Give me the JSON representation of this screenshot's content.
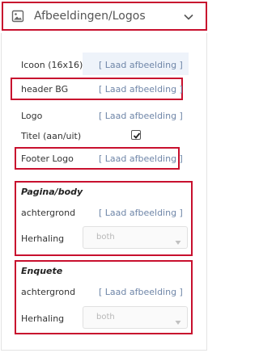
{
  "header": {
    "title": "Afbeeldingen/Logos"
  },
  "rows": {
    "icon": {
      "label": "Icoon (16x16)",
      "action": "[ Laad afbeelding ]"
    },
    "header_bg": {
      "label": "header BG",
      "action": "[ Laad afbeelding ]"
    },
    "logo": {
      "label": "Logo",
      "action": "[ Laad afbeelding ]"
    },
    "title_toggle": {
      "label": "Titel (aan/uit)",
      "checked": true
    },
    "footer_logo": {
      "label": "Footer Logo",
      "action": "[ Laad afbeelding ]"
    }
  },
  "sections": {
    "pagina_body": {
      "title": "Pagina/body",
      "background_label": "achtergrond",
      "background_action": "[ Laad afbeelding ]",
      "repeat_label": "Herhaling",
      "repeat_value": "both"
    },
    "enquete": {
      "title": "Enquete",
      "background_label": "achtergrond",
      "background_action": "[ Laad afbeelding ]",
      "repeat_label": "Herhaling",
      "repeat_value": "both"
    }
  },
  "colors": {
    "highlight": "#c8102e",
    "link": "#6f86a8",
    "shaded_bg": "#eef3fa"
  }
}
